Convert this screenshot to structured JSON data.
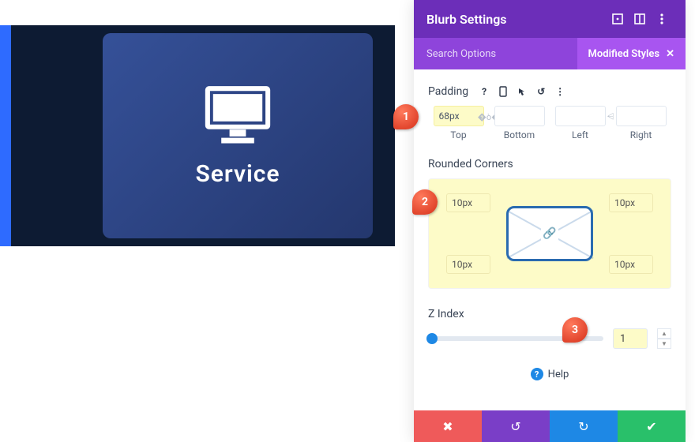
{
  "preview": {
    "card_title": "Service"
  },
  "panel": {
    "title": "Blurb Settings",
    "search_label": "Search Options",
    "filter_chip": "Modified Styles"
  },
  "padding": {
    "label": "Padding",
    "top": {
      "value": "68px",
      "label": "Top"
    },
    "bottom": {
      "value": "",
      "label": "Bottom"
    },
    "left": {
      "value": "",
      "label": "Left"
    },
    "right": {
      "value": "",
      "label": "Right"
    }
  },
  "rounded": {
    "label": "Rounded Corners",
    "tl": "10px",
    "tr": "10px",
    "bl": "10px",
    "br": "10px"
  },
  "zindex": {
    "label": "Z Index",
    "value": "1"
  },
  "help": {
    "label": "Help"
  },
  "annotations": {
    "a1": "1",
    "a2": "2",
    "a3": "3"
  }
}
